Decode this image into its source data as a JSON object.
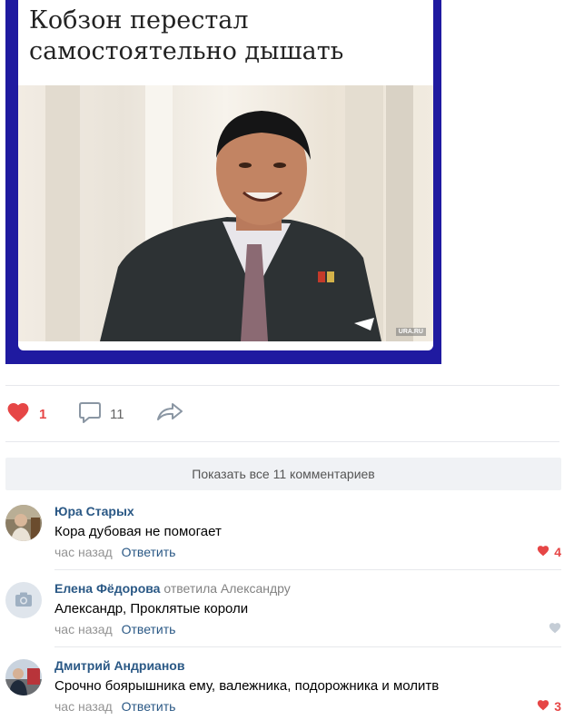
{
  "post": {
    "headline": "Кобзон перестал самостоятельно дышать",
    "watermark": "URA.RU"
  },
  "actions": {
    "like_count": "1",
    "comment_count": "11"
  },
  "show_all_label": "Показать все 11 комментариев",
  "comments": [
    {
      "author": "Юра Старых",
      "reply_to": "",
      "text": "Кора дубовая не помогает",
      "time": "час назад",
      "reply_label": "Ответить",
      "likes": "4",
      "liked": true
    },
    {
      "author": "Елена Фёдорова",
      "reply_to": "ответила Александру",
      "text": "Александр, Проклятые короли",
      "time": "час назад",
      "reply_label": "Ответить",
      "likes": "",
      "liked": false
    },
    {
      "author": "Дмитрий Андрианов",
      "reply_to": "",
      "text": "Срочно боярышника ему, валежника, подорожника и молитв",
      "time": "час назад",
      "reply_label": "Ответить",
      "likes": "3",
      "liked": true
    }
  ],
  "colors": {
    "accent_link": "#2a5885",
    "like_red": "#e64646",
    "image_frame": "#1f1aa0"
  }
}
